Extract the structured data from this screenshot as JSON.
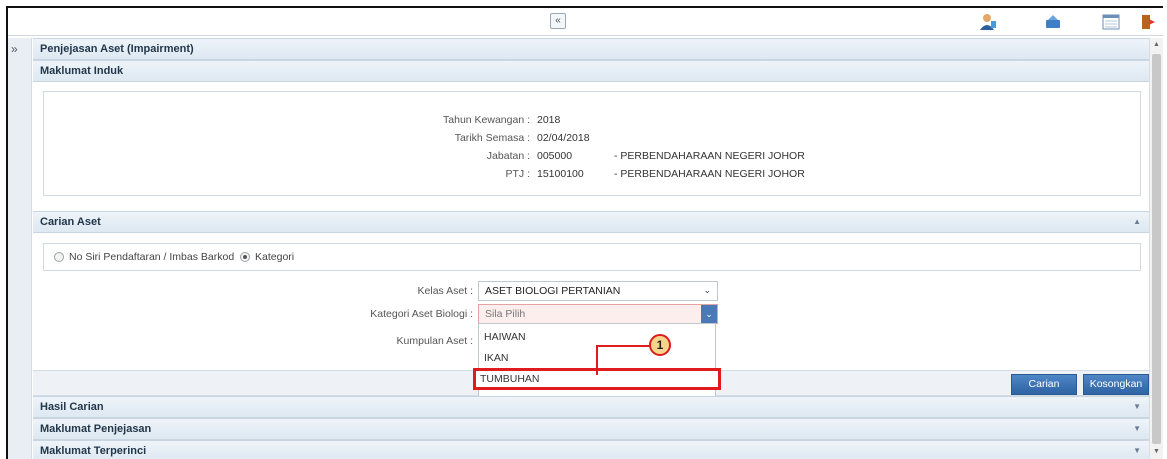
{
  "topbar": {
    "collapse_glyph": "«",
    "icons": [
      "user-support-icon",
      "notification-icon",
      "calendar-icon",
      "logout-icon"
    ]
  },
  "sidebar": {
    "toggle_glyph": "»"
  },
  "page": {
    "title": "Penjejasan Aset (Impairment)"
  },
  "maklumat_induk": {
    "title": "Maklumat Induk",
    "rows": [
      {
        "label": "Tahun Kewangan :",
        "value": "2018",
        "desc": ""
      },
      {
        "label": "Tarikh Semasa :",
        "value": "02/04/2018",
        "desc": ""
      },
      {
        "label": "Jabatan :",
        "value": "005000",
        "desc": "- PERBENDAHARAAN NEGERI JOHOR"
      },
      {
        "label": "PTJ :",
        "value": "15100100",
        "desc": "- PERBENDAHARAAN NEGERI JOHOR"
      }
    ]
  },
  "carian_aset": {
    "title": "Carian Aset",
    "radio_options": [
      {
        "label": "No Siri Pendaftaran / Imbas Barkod",
        "checked": false
      },
      {
        "label": "Kategori",
        "checked": true
      }
    ],
    "kelas_aset": {
      "label": "Kelas Aset :",
      "value": "ASET BIOLOGI PERTANIAN"
    },
    "kategori": {
      "label": "Kategori Aset Biologi :",
      "value": "Sila Pilih"
    },
    "kumpulan": {
      "label": "Kumpulan Aset :"
    },
    "dropdown_options": [
      "HAIWAN",
      "IKAN",
      "TUMBUHAN"
    ],
    "highlighted_option": "TUMBUHAN",
    "buttons": {
      "search": "Carian",
      "clear": "Kosongkan"
    }
  },
  "sections": [
    {
      "title": "Hasil Carian"
    },
    {
      "title": "Maklumat Penjejasan"
    },
    {
      "title": "Maklumat Terperinci"
    }
  ],
  "callout": {
    "number": "1"
  },
  "colors": {
    "accent": "#2f63a3",
    "highlight": "#e01b1b",
    "band": "#dde8f1"
  }
}
